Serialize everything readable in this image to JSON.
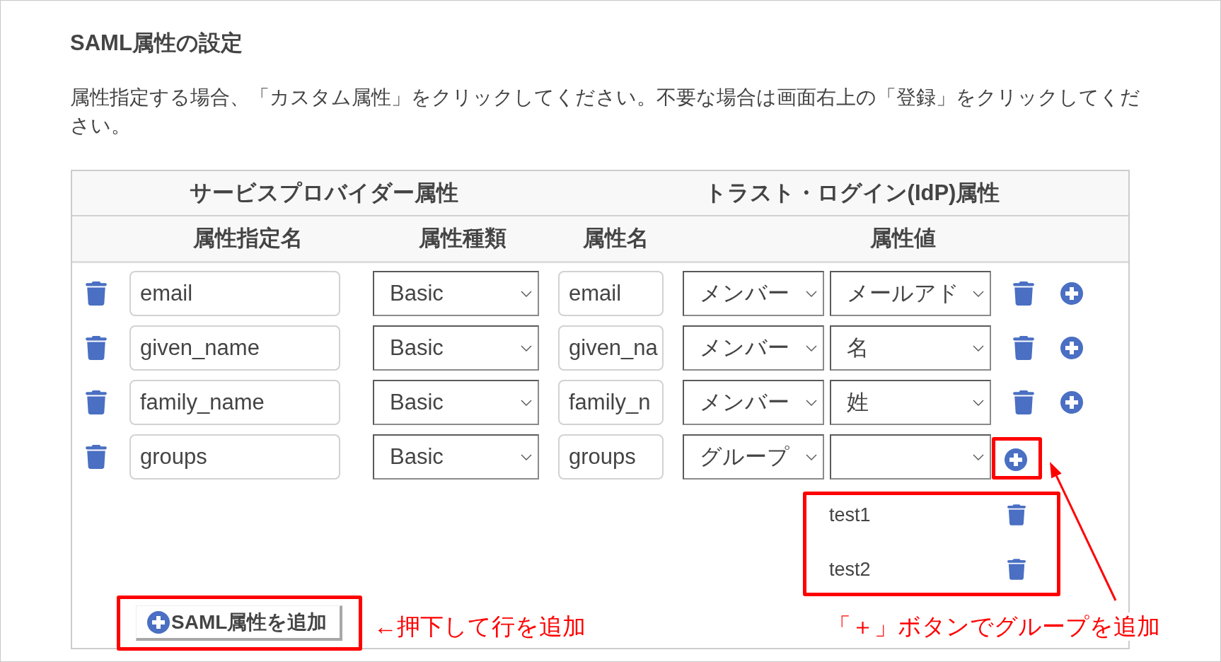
{
  "title": "SAML属性の設定",
  "description": "属性指定する場合、「カスタム属性」をクリックしてください。不要な場合は画面右上の「登録」をクリックしてください。",
  "table": {
    "header_groups": [
      "サービスプロバイダー属性",
      "トラスト・ログイン(IdP)属性"
    ],
    "columns": [
      "属性指定名",
      "属性種類",
      "属性名",
      "属性値"
    ],
    "rows": [
      {
        "kind": "member",
        "name": "email",
        "type": "Basic",
        "attribute_name": "email",
        "source": "メンバー",
        "value": "メールアド"
      },
      {
        "kind": "member",
        "name": "given_name",
        "type": "Basic",
        "attribute_name": "given_na",
        "source": "メンバー",
        "value": "名"
      },
      {
        "kind": "member",
        "name": "family_name",
        "type": "Basic",
        "attribute_name": "family_n",
        "source": "メンバー",
        "value": "姓"
      },
      {
        "kind": "group",
        "name": "groups",
        "type": "Basic",
        "attribute_name": "groups",
        "source": "グループ",
        "add_button": {
          "highlighted": true,
          "note": "「＋」ボタンでグループを追加"
        },
        "groups": {
          "highlighted": true,
          "items": [
            {
              "name": "test1"
            },
            {
              "name": "test2"
            }
          ]
        }
      }
    ]
  },
  "add_button": {
    "label": "SAML属性を追加",
    "highlighted": true,
    "note": "←押下して行を追加"
  }
}
